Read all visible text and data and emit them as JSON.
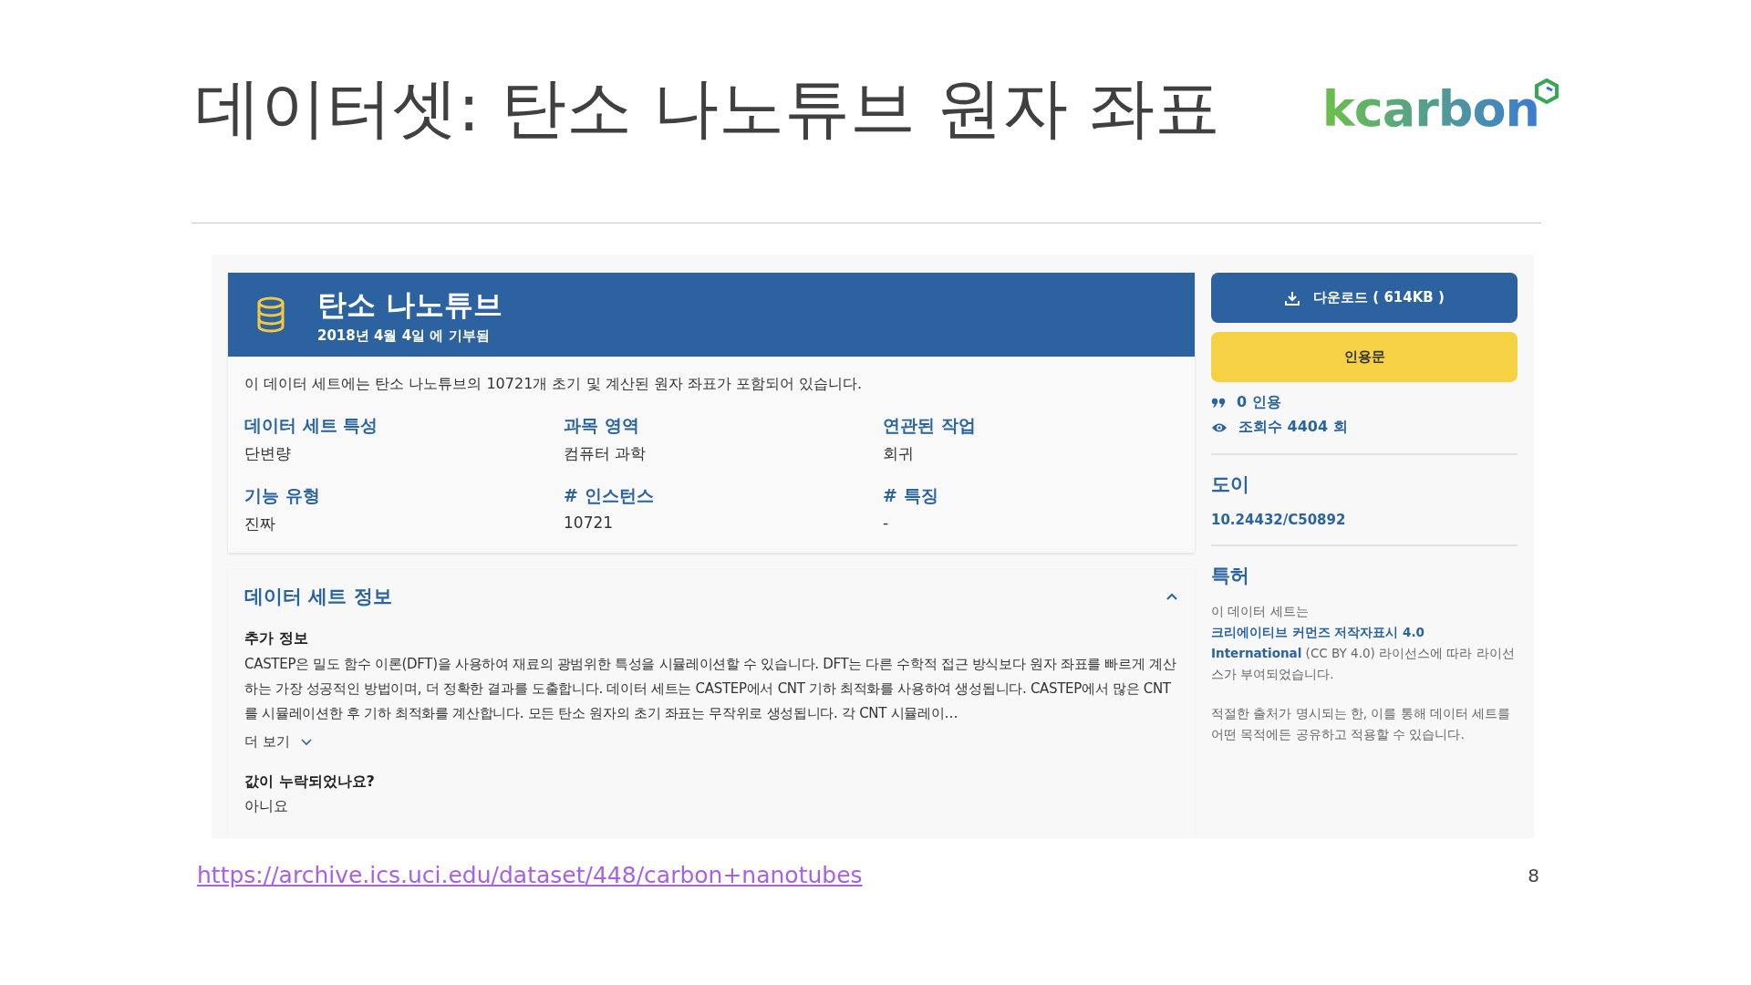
{
  "slide": {
    "title": "데이터셋: 탄소 나노튜브 원자 좌표",
    "logo_text": "kcarbon",
    "source_link": "https://archive.ics.uci.edu/dataset/448/carbon+nanotubes",
    "page_number": "8"
  },
  "dataset": {
    "name": "탄소 나노튜브",
    "donated": "2018년 4월 4일 에 기부됨",
    "summary": "이 데이터 세트에는 탄소 나노튜브의 10721개 초기 및 계산된 원자 좌표가 포함되어 있습니다.",
    "properties": [
      {
        "label": "데이터 세트 특성",
        "value": "단변량"
      },
      {
        "label": "과목 영역",
        "value": "컴퓨터 과학"
      },
      {
        "label": "연관된 작업",
        "value": "회귀"
      },
      {
        "label": "기능 유형",
        "value": "진짜"
      },
      {
        "label": "# 인스턴스",
        "value": "10721"
      },
      {
        "label": "# 특징",
        "value": "-"
      }
    ]
  },
  "info_section": {
    "title": "데이터 세트 정보",
    "expanded": true,
    "additional_label": "추가 정보",
    "additional_text": "CASTEP은 밀도 함수 이론(DFT)을 사용하여 재료의 광범위한 특성을 시뮬레이션할 수 있습니다. DFT는 다른 수학적 접근 방식보다 원자 좌표를 빠르게 계산하는 가장 성공적인 방법이며, 더 정확한 결과를 도출합니다. 데이터 세트는 CASTEP에서 CNT 기하 최적화를 사용하여 생성됩니다. CASTEP에서 많은 CNT를 시뮬레이션한 후 기하 최적화를 계산합니다. 모든 탄소 원자의 초기 좌표는 무작위로 생성됩니다. 각 CNT 시뮬레이…",
    "more_label": "더 보기",
    "missing_label": "값이 누락되었나요?",
    "missing_value": "아니요"
  },
  "sidebar": {
    "download_button": "다운로드 ( 614KB )",
    "cite_button": "인용문",
    "citations": "0 인용",
    "views": "조회수 4404 회",
    "doi_title": "도이",
    "doi": "10.24432/C50892",
    "license_title": "특허",
    "license_before": "이 데이터 세트는 ",
    "license_link": [
      "크리에이티브 커먼즈 저작자표시 4.0",
      "International"
    ],
    "license_after": " (CC BY 4.0) 라이선스에 따라 라이선스가 부여되었습니다.",
    "license_note": "적절한 출처가 명시되는 한, 이를 통해 데이터 세트를 어떤 목적에든 공유하고 적용할 수 있습니다."
  }
}
